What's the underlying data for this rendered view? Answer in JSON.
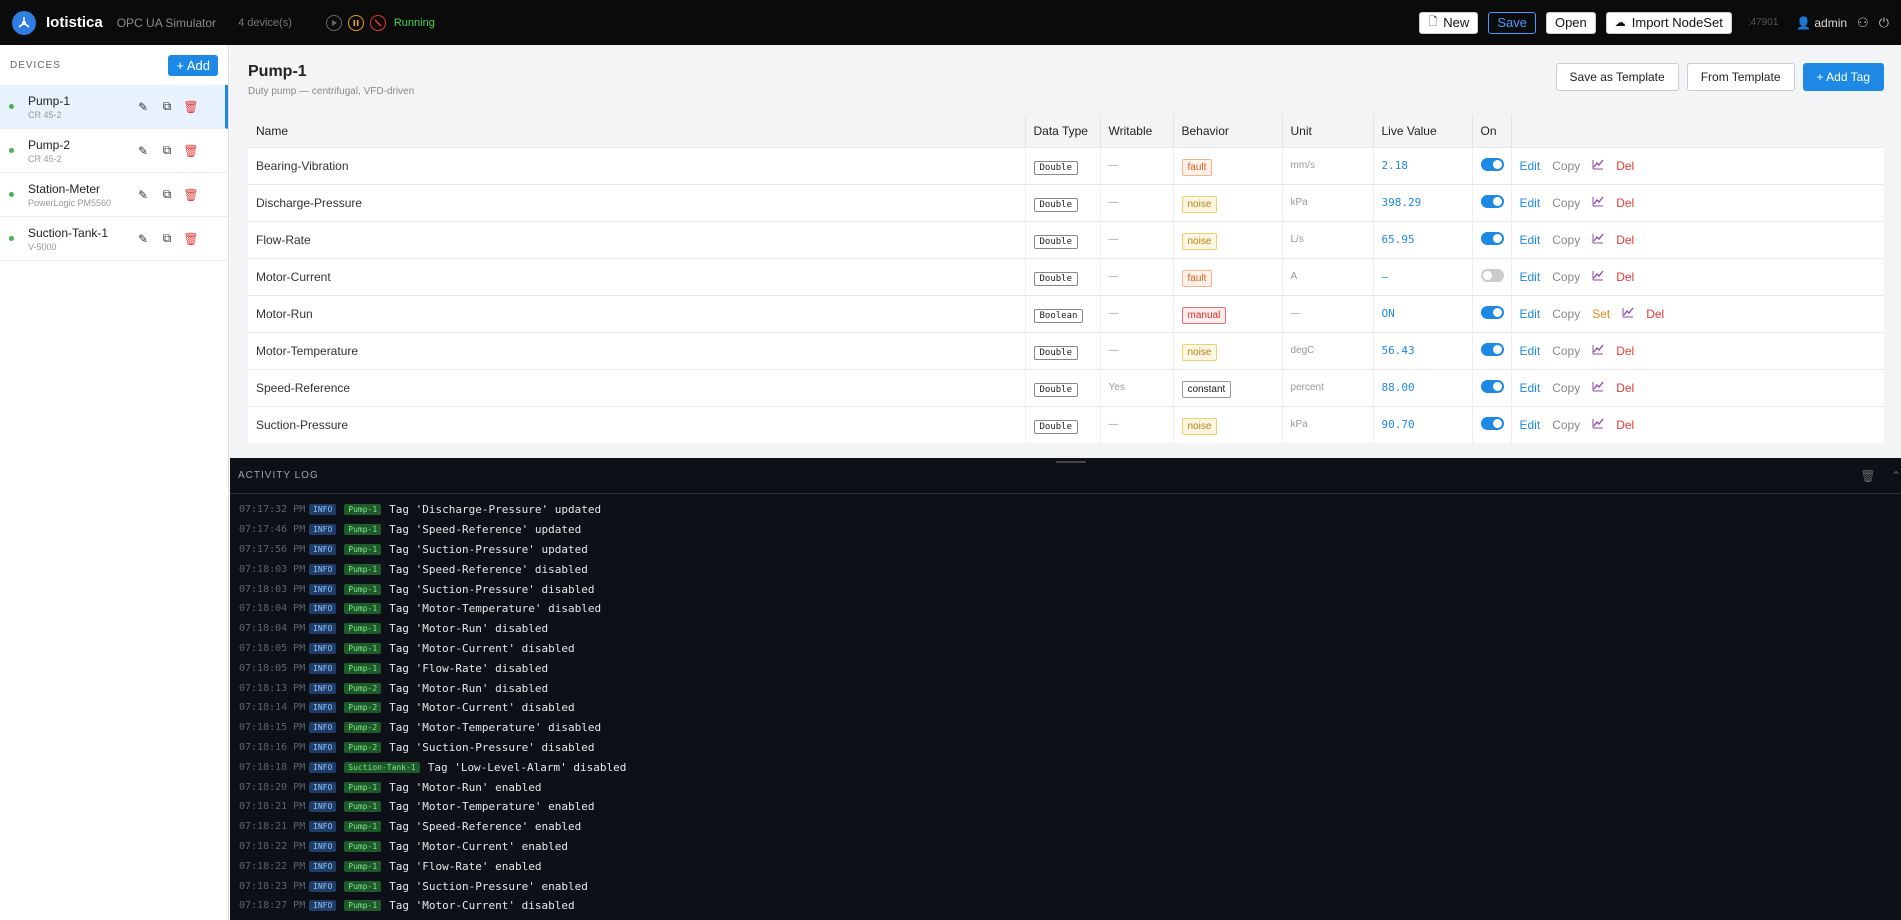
{
  "app": {
    "brand": "Iotistica",
    "subtitle": "OPC UA Simulator",
    "device_count": "4 device(s)",
    "status": "Running",
    "port": ":47901",
    "user": "admin",
    "status_color": "#4bd35a",
    "accent": "#1e88e5"
  },
  "toolbar": {
    "new_label": "New",
    "save_label": "Save",
    "open_label": "Open",
    "import_label": "Import NodeSet"
  },
  "sidebar": {
    "title": "DEVICES",
    "add_label": "+ Add",
    "devices": [
      {
        "name": "Pump-1",
        "model": "CR 45-2"
      },
      {
        "name": "Pump-2",
        "model": "CR 45-2"
      },
      {
        "name": "Station-Meter",
        "model": "PowerLogic PM5560"
      },
      {
        "name": "Suction-Tank-1",
        "model": "V-5000"
      }
    ]
  },
  "main": {
    "title": "Pump-1",
    "description": "Duty pump — centrifugal, VFD-driven",
    "save_template_label": "Save as Template",
    "from_template_label": "From Template",
    "add_tag_label": "+ Add Tag",
    "columns": [
      "Name",
      "Data Type",
      "Writable",
      "Behavior",
      "Unit",
      "Live Value",
      "On"
    ],
    "actions": {
      "edit": "Edit",
      "copy": "Copy",
      "set": "Set",
      "del": "Del"
    },
    "rows": [
      {
        "name": "Bearing-Vibration",
        "type": "Double",
        "writable": "—",
        "behavior": "fault",
        "unit": "mm/s",
        "value": "2.18",
        "on": true
      },
      {
        "name": "Discharge-Pressure",
        "type": "Double",
        "writable": "—",
        "behavior": "noise",
        "unit": "kPa",
        "value": "398.29",
        "on": true
      },
      {
        "name": "Flow-Rate",
        "type": "Double",
        "writable": "—",
        "behavior": "noise",
        "unit": "L/s",
        "value": "65.95",
        "on": true
      },
      {
        "name": "Motor-Current",
        "type": "Double",
        "writable": "—",
        "behavior": "fault",
        "unit": "A",
        "value": "—",
        "on": false
      },
      {
        "name": "Motor-Run",
        "type": "Boolean",
        "writable": "—",
        "behavior": "manual",
        "unit": "—",
        "value": "ON",
        "on": true
      },
      {
        "name": "Motor-Temperature",
        "type": "Double",
        "writable": "—",
        "behavior": "noise",
        "unit": "degC",
        "value": "56.43",
        "on": true
      },
      {
        "name": "Speed-Reference",
        "type": "Double",
        "writable": "Yes",
        "behavior": "constant",
        "unit": "percent",
        "value": "88.00",
        "on": true
      },
      {
        "name": "Suction-Pressure",
        "type": "Double",
        "writable": "—",
        "behavior": "noise",
        "unit": "kPa",
        "value": "90.70",
        "on": true
      }
    ]
  },
  "log": {
    "title": "ACTIVITY LOG",
    "entries": [
      {
        "ts": "07:17:32 PM",
        "level": "INFO",
        "device": "Pump-1",
        "msg": "Tag 'Discharge-Pressure' updated"
      },
      {
        "ts": "07:17:46 PM",
        "level": "INFO",
        "device": "Pump-1",
        "msg": "Tag 'Speed-Reference' updated"
      },
      {
        "ts": "07:17:56 PM",
        "level": "INFO",
        "device": "Pump-1",
        "msg": "Tag 'Suction-Pressure' updated"
      },
      {
        "ts": "07:18:03 PM",
        "level": "INFO",
        "device": "Pump-1",
        "msg": "Tag 'Speed-Reference' disabled"
      },
      {
        "ts": "07:18:03 PM",
        "level": "INFO",
        "device": "Pump-1",
        "msg": "Tag 'Suction-Pressure' disabled"
      },
      {
        "ts": "07:18:04 PM",
        "level": "INFO",
        "device": "Pump-1",
        "msg": "Tag 'Motor-Temperature' disabled"
      },
      {
        "ts": "07:18:04 PM",
        "level": "INFO",
        "device": "Pump-1",
        "msg": "Tag 'Motor-Run' disabled"
      },
      {
        "ts": "07:18:05 PM",
        "level": "INFO",
        "device": "Pump-1",
        "msg": "Tag 'Motor-Current' disabled"
      },
      {
        "ts": "07:18:05 PM",
        "level": "INFO",
        "device": "Pump-1",
        "msg": "Tag 'Flow-Rate' disabled"
      },
      {
        "ts": "07:18:13 PM",
        "level": "INFO",
        "device": "Pump-2",
        "msg": "Tag 'Motor-Run' disabled"
      },
      {
        "ts": "07:18:14 PM",
        "level": "INFO",
        "device": "Pump-2",
        "msg": "Tag 'Motor-Current' disabled"
      },
      {
        "ts": "07:18:15 PM",
        "level": "INFO",
        "device": "Pump-2",
        "msg": "Tag 'Motor-Temperature' disabled"
      },
      {
        "ts": "07:18:16 PM",
        "level": "INFO",
        "device": "Pump-2",
        "msg": "Tag 'Suction-Pressure' disabled"
      },
      {
        "ts": "07:18:18 PM",
        "level": "INFO",
        "device": "Suction-Tank-1",
        "msg": "Tag 'Low-Level-Alarm' disabled"
      },
      {
        "ts": "07:18:20 PM",
        "level": "INFO",
        "device": "Pump-1",
        "msg": "Tag 'Motor-Run' enabled"
      },
      {
        "ts": "07:18:21 PM",
        "level": "INFO",
        "device": "Pump-1",
        "msg": "Tag 'Motor-Temperature' enabled"
      },
      {
        "ts": "07:18:21 PM",
        "level": "INFO",
        "device": "Pump-1",
        "msg": "Tag 'Speed-Reference' enabled"
      },
      {
        "ts": "07:18:22 PM",
        "level": "INFO",
        "device": "Pump-1",
        "msg": "Tag 'Motor-Current' enabled"
      },
      {
        "ts": "07:18:22 PM",
        "level": "INFO",
        "device": "Pump-1",
        "msg": "Tag 'Flow-Rate' enabled"
      },
      {
        "ts": "07:18:23 PM",
        "level": "INFO",
        "device": "Pump-1",
        "msg": "Tag 'Suction-Pressure' enabled"
      },
      {
        "ts": "07:18:27 PM",
        "level": "INFO",
        "device": "Pump-1",
        "msg": "Tag 'Motor-Current' disabled"
      }
    ]
  }
}
